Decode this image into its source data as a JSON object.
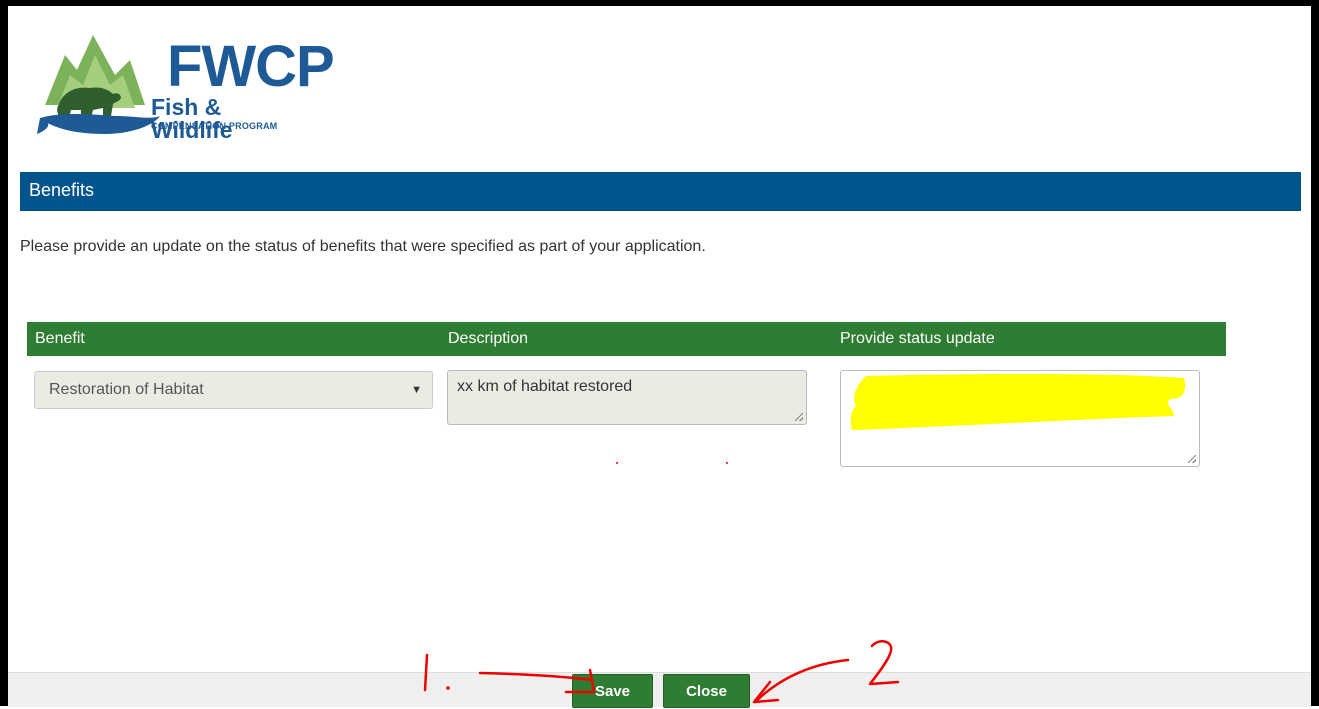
{
  "logo": {
    "title": "FWCP",
    "subtitle": "Fish & Wildlife",
    "tagline": "COMPENSATION PROGRAM"
  },
  "section": {
    "title": "Benefits",
    "intro": "Please provide an update on the status of benefits that were specified as part of your application."
  },
  "table": {
    "headers": [
      "Benefit",
      "Description",
      "Provide status update"
    ],
    "row": {
      "benefit_selected": "Restoration of Habitat",
      "description": "xx km of habitat restored",
      "status_value": ""
    }
  },
  "footer": {
    "save_label": "Save",
    "close_label": "Close"
  },
  "annotations": {
    "label_1": "1.",
    "label_2": "2"
  },
  "colors": {
    "header_blue": "#02548c",
    "table_green": "#2e7d32",
    "highlight_yellow": "#ffff00",
    "annotation_red": "#e00000"
  }
}
